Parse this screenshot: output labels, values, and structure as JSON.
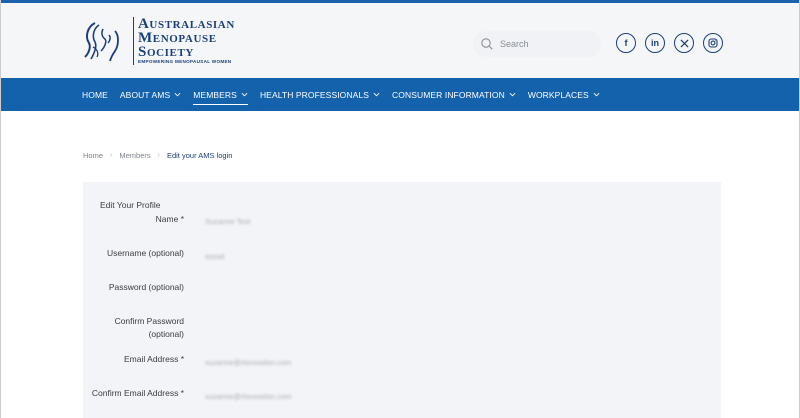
{
  "logo": {
    "line1": "Australasian",
    "line2": "Menopause",
    "line3": "Society",
    "tagline": "EMPOWERING MENOPAUSAL WOMEN"
  },
  "search": {
    "placeholder": "Search"
  },
  "socials": [
    {
      "name": "facebook",
      "glyph": "f"
    },
    {
      "name": "linkedin",
      "glyph": "in"
    },
    {
      "name": "x",
      "glyph": "X"
    },
    {
      "name": "instagram",
      "glyph": ""
    }
  ],
  "nav": {
    "items": [
      {
        "label": "HOME",
        "dropdown": false
      },
      {
        "label": "ABOUT AMS",
        "dropdown": true
      },
      {
        "label": "MEMBERS",
        "dropdown": true,
        "active": true
      },
      {
        "label": "HEALTH PROFESSIONALS",
        "dropdown": true
      },
      {
        "label": "CONSUMER INFORMATION",
        "dropdown": true
      },
      {
        "label": "WORKPLACES",
        "dropdown": true
      }
    ]
  },
  "breadcrumb": {
    "home": "Home",
    "members": "Members",
    "current": "Edit your AMS login"
  },
  "form": {
    "title": "Edit Your Profile",
    "fields": {
      "name": {
        "label": "Name *",
        "value": "Suzanne Test"
      },
      "username": {
        "label": "Username (optional)",
        "value": "ssssd"
      },
      "password": {
        "label": "Password (optional)"
      },
      "confirm_password": {
        "label": "Confirm Password (optional)"
      },
      "email": {
        "label": "Email Address *",
        "value": "suzanne@rlsnowdon.com"
      },
      "confirm_email": {
        "label": "Confirm Email Address *",
        "value": "suzanne@rlsnowdon.com"
      }
    }
  },
  "colors": {
    "brand_navy": "#1b3f7a",
    "nav_blue": "#1562ac",
    "panel_bg": "#f2f4f7"
  }
}
